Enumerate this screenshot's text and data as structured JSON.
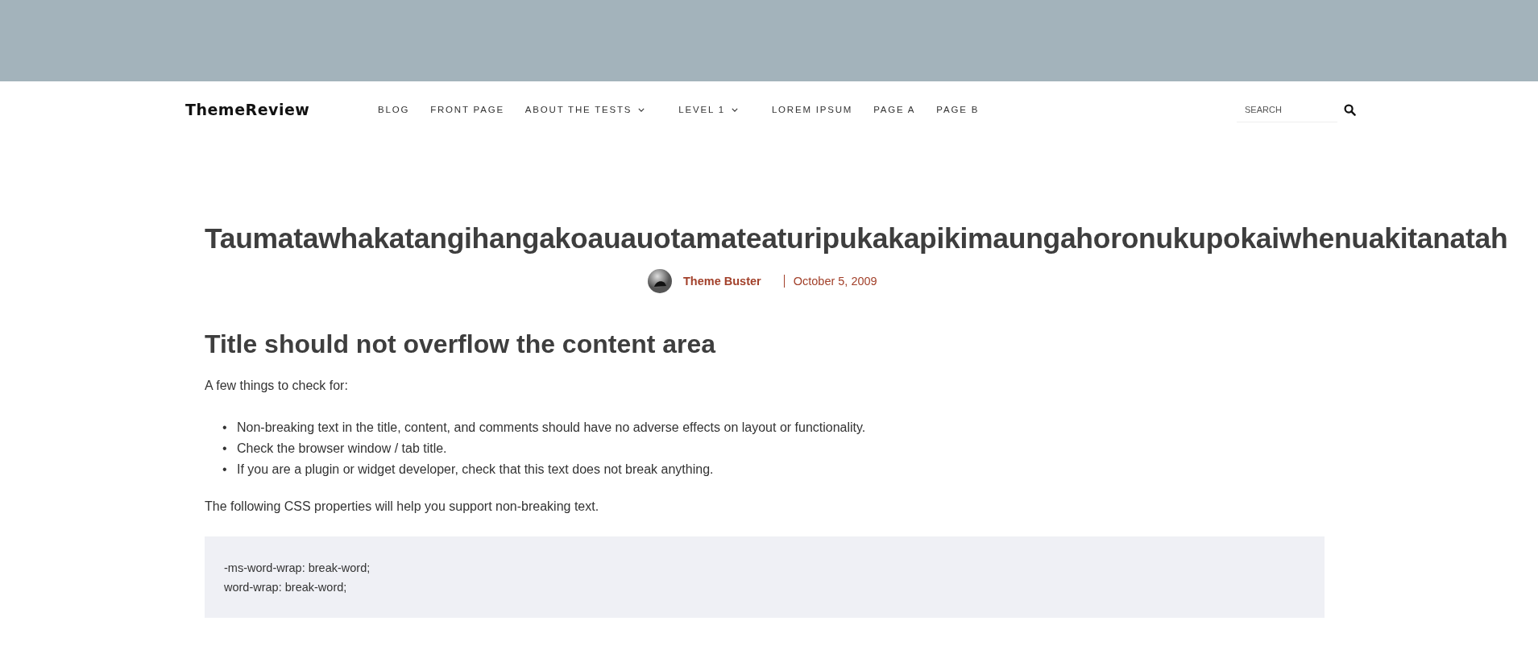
{
  "header": {
    "logo": "ThemeReview",
    "nav": [
      {
        "label": "BLOG",
        "has_submenu": false
      },
      {
        "label": "FRONT PAGE",
        "has_submenu": false
      },
      {
        "label": "ABOUT THE TESTS",
        "has_submenu": true
      },
      {
        "label": "LEVEL 1",
        "has_submenu": true
      },
      {
        "label": "LOREM IPSUM",
        "has_submenu": false
      },
      {
        "label": "PAGE A",
        "has_submenu": false
      },
      {
        "label": "PAGE B",
        "has_submenu": false
      }
    ],
    "search": {
      "placeholder": "SEARCH"
    }
  },
  "post": {
    "title": "Taumatawhakatangihangakoauauotamateaturipukakapikimaungahoronukupokaiwhenuakitanatah",
    "author": "Theme Buster",
    "date": "October 5, 2009",
    "heading": "Title should not overflow the content area",
    "intro": "A few things to check for:",
    "bullets": [
      {
        "marker": "•",
        "text": "Non-breaking text in the title, content, and comments should have no adverse effects on layout or functionality."
      },
      {
        "marker": "•",
        "text": "Check the browser window / tab title."
      },
      {
        "marker": "•",
        "text": "If you are a plugin or widget developer, check that this text does not break anything."
      }
    ],
    "outro": "The following CSS properties will help you support non-breaking text.",
    "code": [
      "-ms-word-wrap: break-word;",
      "word-wrap: break-word;"
    ]
  }
}
